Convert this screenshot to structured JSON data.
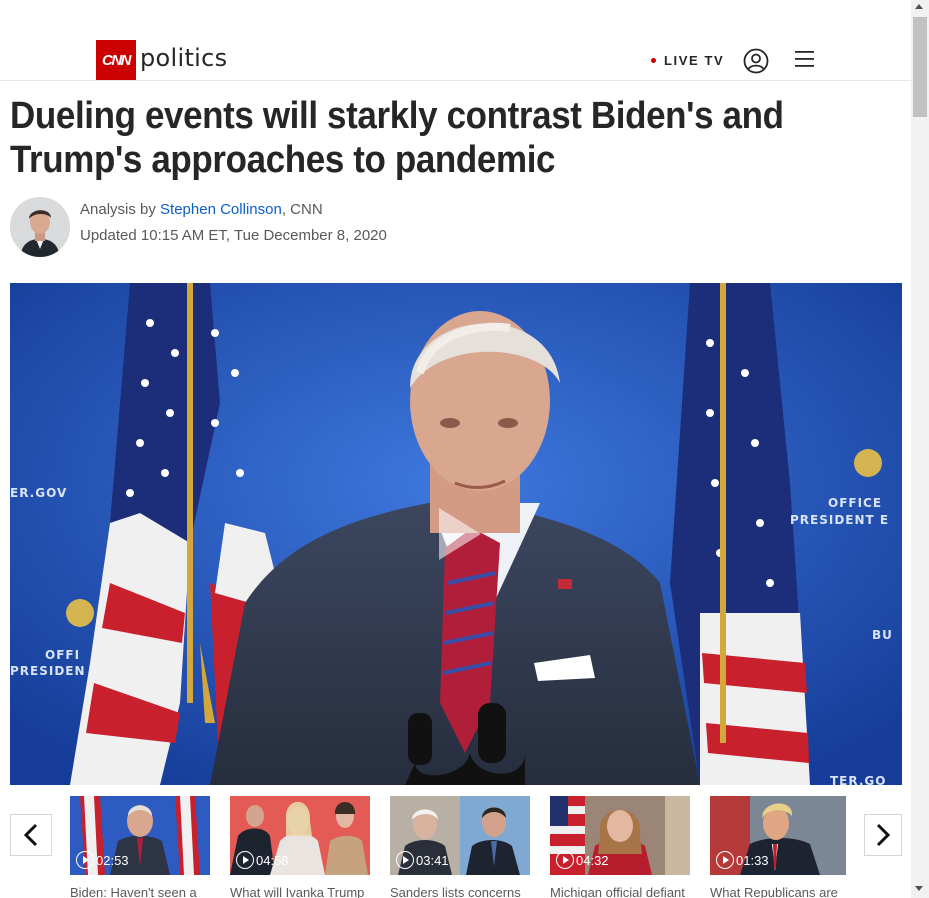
{
  "header": {
    "logo_text": "CNN",
    "section": "politics",
    "live_tv": "LIVE TV",
    "icons": {
      "account": "user-circle-icon",
      "menu": "hamburger-menu-icon"
    }
  },
  "article": {
    "headline": "Dueling events will starkly contrast Biden's and Trump's approaches to pandemic",
    "byline_prefix": "Analysis by ",
    "author": "Stephen Collinson",
    "byline_suffix": ", CNN",
    "updated": "Updated 10:15 AM ET, Tue December 8, 2020"
  },
  "video": {
    "backdrop_text_left_1": "ER.GOV",
    "backdrop_text_left_2": "OFFI",
    "backdrop_text_left_3": "PRESIDEN",
    "backdrop_text_right_1": "OFFICE",
    "backdrop_text_right_2": "PRESIDENT E",
    "backdrop_text_right_3": "BU",
    "backdrop_text_right_4": "TER.GO"
  },
  "carousel": {
    "items": [
      {
        "duration": "02:53",
        "title": "Biden: Haven't seen a"
      },
      {
        "duration": "04:58",
        "title": "What will Ivanka Trump"
      },
      {
        "duration": "03:41",
        "title": "Sanders lists concerns"
      },
      {
        "duration": "04:32",
        "title": "Michigan official defiant"
      },
      {
        "duration": "01:33",
        "title": "What Republicans are"
      }
    ]
  },
  "colors": {
    "brand_red": "#cc0000",
    "link_blue": "#0c5fc4",
    "backdrop_blue": "#1b4ab3"
  }
}
